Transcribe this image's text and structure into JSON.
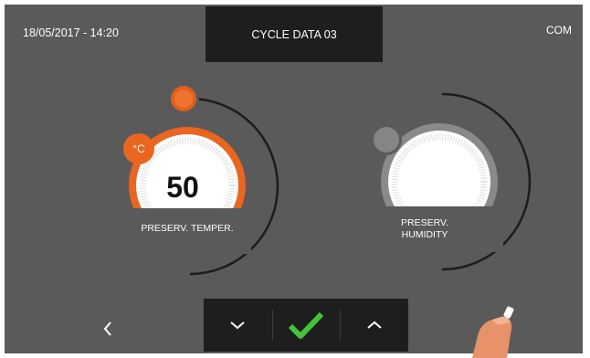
{
  "header": {
    "datetime": "18/05/2017 - 14:20",
    "title": "CYCLE DATA 03",
    "status": "COM"
  },
  "temperature_dial": {
    "value": "50",
    "unit": "°C",
    "label": "PRESERV. TEMPER.",
    "accent_color": "#e8661f"
  },
  "humidity_dial": {
    "label_line1": "PRESERV.",
    "label_line2": "HUMIDITY",
    "accent_color": "#8a8a8a"
  },
  "controls": {
    "back": "chevron-left-icon",
    "down": "chevron-down-icon",
    "confirm": "check-icon",
    "up": "chevron-up-icon",
    "confirm_color": "#44c23a"
  }
}
